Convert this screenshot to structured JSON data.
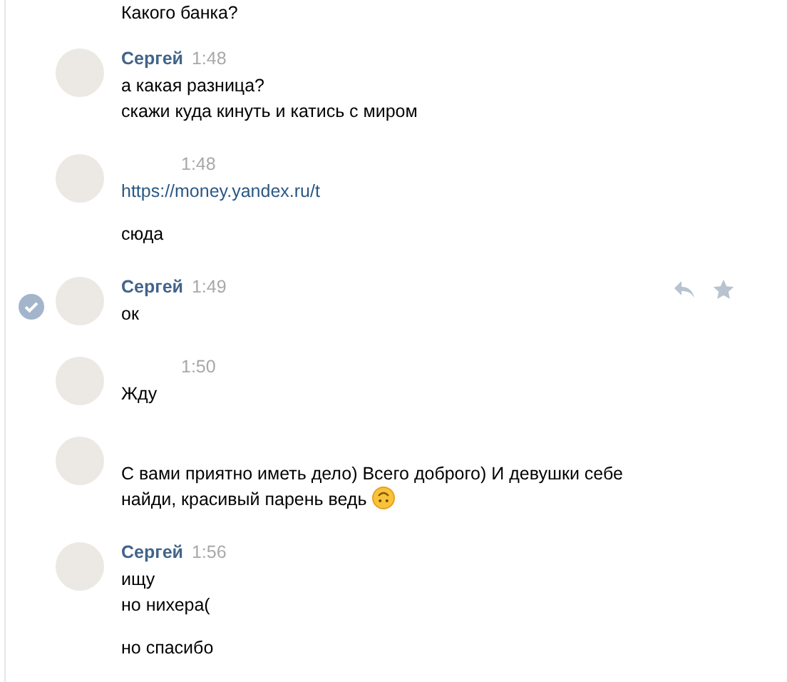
{
  "messages": [
    {
      "kind": "continuation",
      "paragraphs": [
        [
          {
            "kind": "text",
            "text": "Какого банка?"
          }
        ]
      ]
    },
    {
      "kind": "full",
      "author": "Сергей",
      "time": "1:48",
      "selected": false,
      "show_actions": false,
      "paragraphs": [
        [
          {
            "kind": "text",
            "text": "а какая разница?"
          },
          {
            "kind": "text",
            "text": "скажи куда кинуть и катись с миром"
          }
        ]
      ]
    },
    {
      "kind": "full",
      "time": "1:48",
      "selected": false,
      "show_actions": false,
      "paragraphs": [
        [
          {
            "kind": "link",
            "text": "https://money.yandex.ru/t"
          }
        ],
        [
          {
            "kind": "text",
            "text": "сюда"
          }
        ]
      ]
    },
    {
      "kind": "full",
      "author": "Сергей",
      "time": "1:49",
      "selected": true,
      "show_actions": true,
      "paragraphs": [
        [
          {
            "kind": "text",
            "text": "ок"
          }
        ]
      ]
    },
    {
      "kind": "full",
      "time": "1:50",
      "selected": false,
      "show_actions": false,
      "paragraphs": [
        [
          {
            "kind": "text",
            "text": "Жду"
          }
        ]
      ]
    },
    {
      "kind": "full",
      "selected": false,
      "show_actions": false,
      "paragraphs": [
        [
          {
            "kind": "text",
            "text": "С вами приятно иметь дело) Всего доброго) И девушки себе"
          },
          {
            "kind": "text",
            "text": "найди, красивый парень ведь",
            "emoji": true
          }
        ]
      ]
    },
    {
      "kind": "full",
      "author": "Сергей",
      "time": "1:56",
      "selected": false,
      "show_actions": false,
      "paragraphs": [
        [
          {
            "kind": "text",
            "text": "ищу"
          },
          {
            "kind": "text",
            "text": "но нихера("
          }
        ],
        [
          {
            "kind": "text",
            "text": "но спасибо"
          }
        ]
      ]
    }
  ]
}
